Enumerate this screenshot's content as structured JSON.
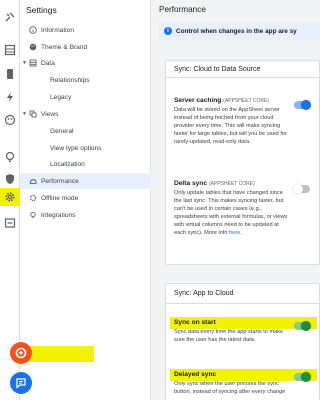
{
  "colors": {
    "accent": "#1a73e8",
    "highlight": "#f2f200",
    "toggle_green": "#1e8e3e",
    "fab_orange": "#f4511e",
    "fab_blue": "#1a73e8"
  },
  "rail": {
    "icons": [
      "apps-icon",
      "table-icon",
      "phone-icon",
      "bolt-icon",
      "paint-icon",
      "bulb-icon",
      "shield-icon",
      "gear-icon",
      "integrations-icon"
    ]
  },
  "settings": {
    "title": "Settings",
    "items": [
      {
        "label": "Information",
        "icon": "info-icon"
      },
      {
        "label": "Theme & Brand",
        "icon": "palette-icon"
      },
      {
        "label": "Data",
        "icon": "table-icon"
      },
      {
        "label": "Relationships"
      },
      {
        "label": "Legacy"
      },
      {
        "label": "Views",
        "icon": "views-icon"
      },
      {
        "label": "General"
      },
      {
        "label": "View type options"
      },
      {
        "label": "Localization"
      },
      {
        "label": "Performance",
        "icon": "cloud-check-icon"
      },
      {
        "label": "Offline mode",
        "icon": "gear-icon"
      },
      {
        "label": "Integrations",
        "icon": "integrations-icon"
      }
    ]
  },
  "main": {
    "title": "Performance",
    "banner": "Control when changes in the app are sy",
    "card1": {
      "heading": "Sync: Cloud to Data Source",
      "server_caching": {
        "title": "Server caching",
        "tag": "(APPSHEET CORE)",
        "desc": "Data will be stored on the AppSheet server instead of being fetched from your cloud provider every time. This will make syncing faster for large tables, but will you be used for rarely-updated, read-only data."
      },
      "delta_sync": {
        "title": "Delta sync",
        "tag": "(APPSHEET CORE)",
        "desc": "Only update tables that have changed since the last sync. This makes syncing faster, but can't be used in certain cases (e.g., spreadsheets with external formulas, or views with virtual columns need to be updated at each sync). More info ",
        "link": "here"
      }
    },
    "card2": {
      "heading": "Sync: App to Cloud",
      "sync_on_start": {
        "title": "Sync on start",
        "desc": "Sync data every time the app starts to make sure the user has the latest data."
      },
      "delayed_sync": {
        "title": "Delayed sync",
        "desc": "Only sync when the user presses the sync button, instead of syncing after every change"
      }
    }
  }
}
